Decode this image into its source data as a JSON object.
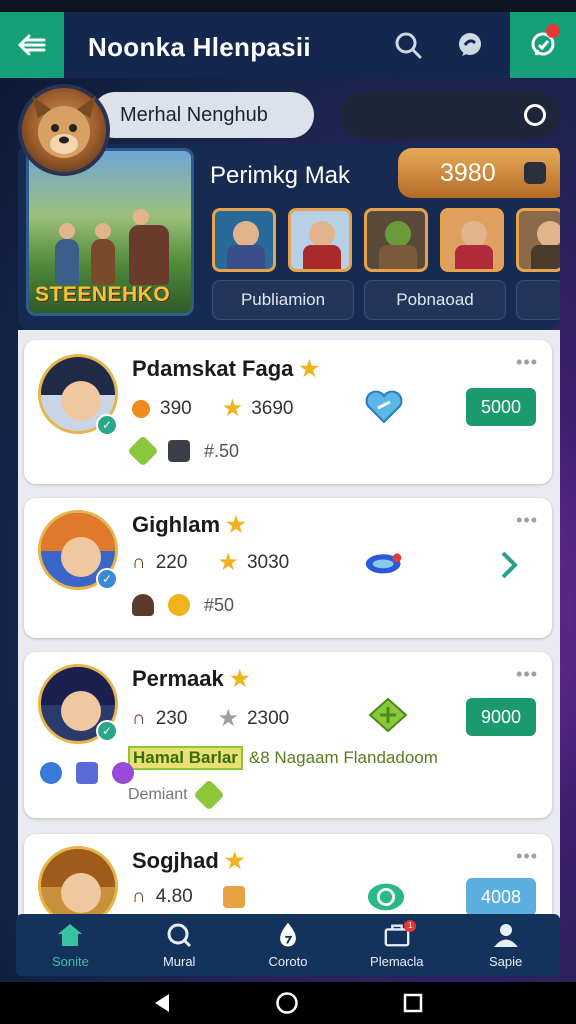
{
  "app_bar": {
    "title": "Noonka Hlenpasii"
  },
  "header": {
    "username": "Merhal Nenghub",
    "panel_title": "Perimkg Mak",
    "score": "3980",
    "game_logo": "STEENEHKO",
    "buttons": [
      "Publiamion",
      "Pobnaoad"
    ]
  },
  "cards": [
    {
      "name": "Pdamskat Faga",
      "coins": "390",
      "stars": "3690",
      "sub_value": "#.50",
      "price": "5000",
      "price_style": "green",
      "action_icon": "heart-ticket-icon"
    },
    {
      "name": "Gighlam",
      "coins": "220",
      "stars": "3030",
      "sub_value": "#50",
      "price": "",
      "price_style": "chevron",
      "action_icon": "shell-icon"
    },
    {
      "name": "Permaak",
      "coins": "230",
      "stars": "2300",
      "sub_value": "",
      "price": "9000",
      "price_style": "green",
      "action_icon": "clover-icon",
      "promo_tag": "Hamal Barlar",
      "promo_text": "&8 Nagaam Flandadoom",
      "footer_label": "Demiant"
    },
    {
      "name": "Sogjhad",
      "coins": "4.80",
      "stars": "",
      "sub_value": "",
      "price": "4008",
      "price_style": "light",
      "action_icon": "swirl-icon"
    }
  ],
  "bottom_nav": [
    {
      "label": "Sonite",
      "icon": "home-icon",
      "active": true
    },
    {
      "label": "Mural",
      "icon": "search-icon",
      "active": false
    },
    {
      "label": "Coroto",
      "icon": "drop-icon",
      "active": false
    },
    {
      "label": "Plemacla",
      "icon": "briefcase-icon",
      "active": false,
      "badge": "1"
    },
    {
      "label": "Sapie",
      "icon": "person-icon",
      "active": false
    }
  ],
  "colors": {
    "accent": "#16a07a",
    "header_bg": "#14284f",
    "nav_bg": "#14335c",
    "score": "#d48a3a"
  }
}
